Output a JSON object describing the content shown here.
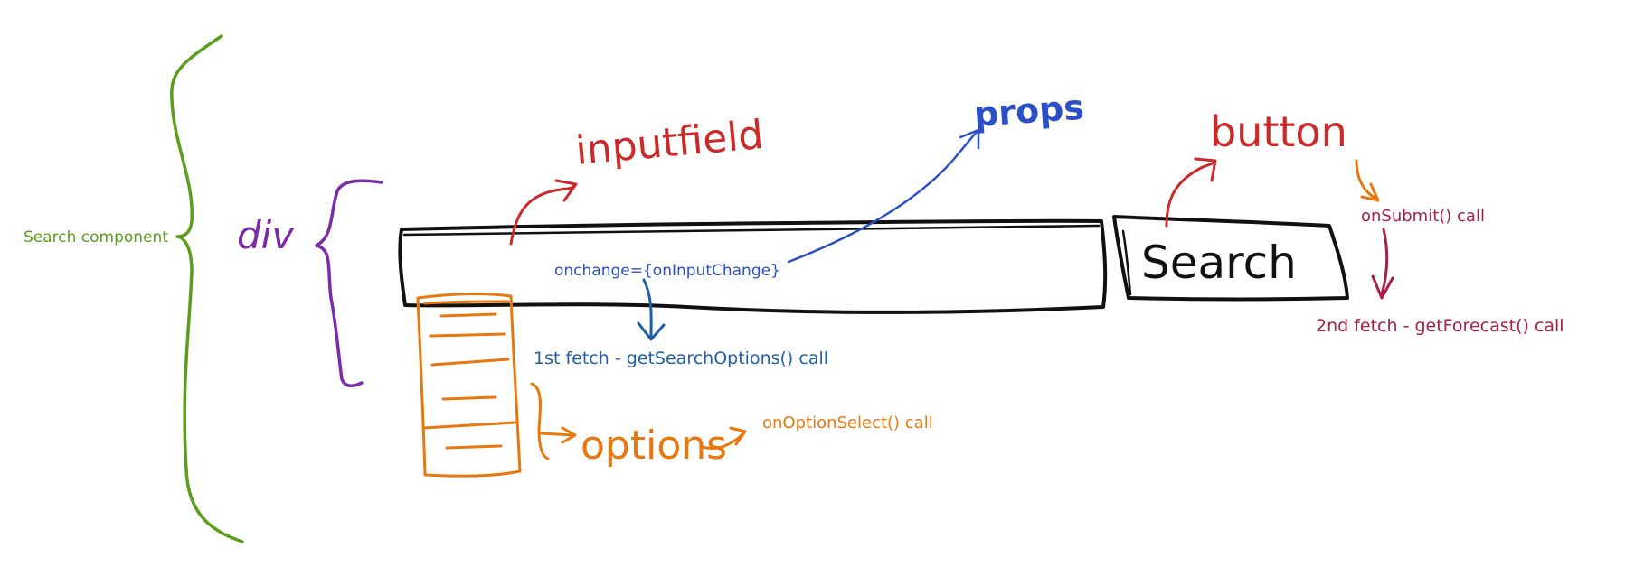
{
  "colors": {
    "green": "#5a9e1c",
    "purple": "#7b2aa8",
    "black": "#111111",
    "red": "#cc2a2a",
    "blue": "#2a4fc7",
    "darkblue": "#1f5fa8",
    "orange": "#e6780f",
    "crimson": "#a6204a"
  },
  "labels": {
    "search_component": "Search component",
    "div": "div",
    "inputfield": "inputfield",
    "props": "props",
    "button": "button",
    "search_button": "Search",
    "onchange": "onchange={onInputChange}",
    "first_fetch": "1st fetch - getSearchOptions() call",
    "options": "options",
    "on_option_select": "onOptionSelect() call",
    "on_submit": "onSubmit() call",
    "second_fetch": "2nd fetch - getForecast() call"
  }
}
